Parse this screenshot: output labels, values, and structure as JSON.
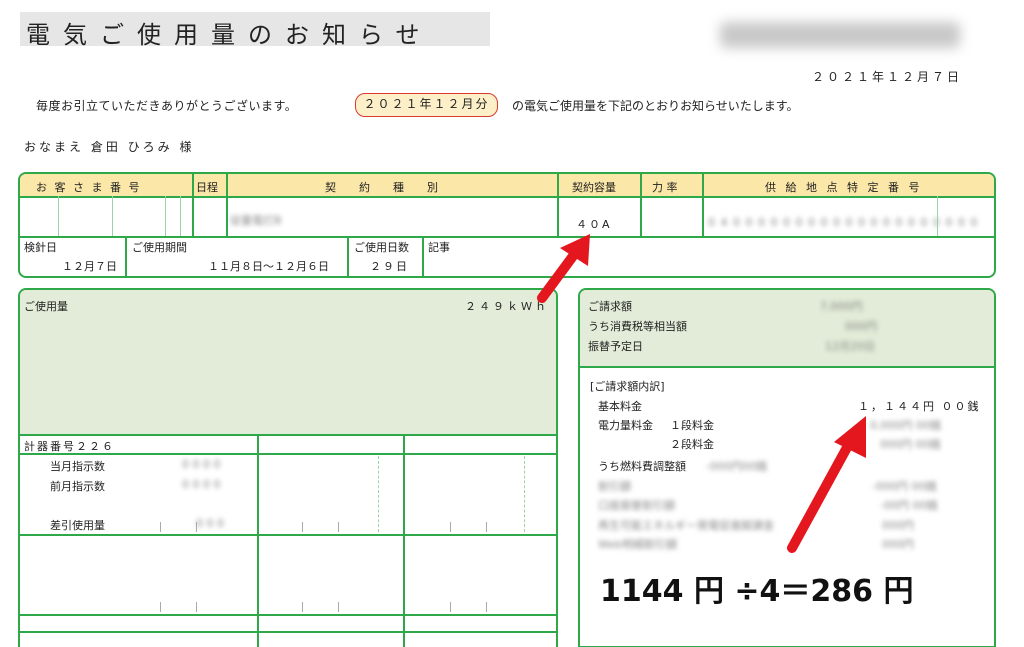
{
  "header": {
    "title": "電気ご使用量のお知らせ",
    "company": "中部電力ミライズ株式会社",
    "date": "２０２１年１２月７日"
  },
  "greeting": {
    "prefix": "毎度お引立ていただきありがとうございます。",
    "period": "２０２１年１２月分",
    "suffix": "の電気ご使用量を下記のとおりお知らせいたします。"
  },
  "customer": {
    "name_line": "おなまえ 倉田 ひろみ 様"
  },
  "contract_table": {
    "col_customer_no": "お 客 さ ま 番 号",
    "col_day": "日程",
    "col_contract_type": "契　約　種　別",
    "col_capacity": "契約容量",
    "col_power_factor": "力 率",
    "col_supply_point": "供 給 地 点 特 定 番 号",
    "contract_type_value": "従量電灯B",
    "capacity_value": "４０A",
    "supply_point_value": "0 4 0 0 0 0 0 0 0 0 0 0 0 0 0 0 0 0 0 0 0 0",
    "meter_day_label": "検針日",
    "meter_day_value": "１２月７日",
    "period_label": "ご使用期間",
    "period_value": "１１月８日～１２月６日",
    "days_label": "ご使用日数",
    "days_value": "２９日",
    "notes_label": "記事"
  },
  "usage": {
    "label": "ご使用量",
    "value": "２４９ｋＷｈ",
    "meter_no_label": "計器番号２２６",
    "current_label": "当月指示数",
    "current_value": "0 0 0 0",
    "previous_label": "前月指示数",
    "previous_value": "0 0 0 0",
    "diff_label": "差引使用量",
    "diff_value": "0 0 0"
  },
  "billing": {
    "amount_label": "ご請求額",
    "amount_value": "7,000円",
    "tax_label": "うち消費税等相当額",
    "tax_value": "000円",
    "transfer_label": "振替予定日",
    "transfer_value": "12月20日",
    "breakdown_label": "[ご請求額内訳]",
    "base_label": "基本料金",
    "base_value": "１，１４４円 ００銭",
    "energy_label": "電力量料金",
    "tier1_label": "１段料金",
    "tier1_value": "0,000円 00銭",
    "tier2_label": "２段料金",
    "tier2_value": "000円 00銭",
    "fuel_label": "うち燃料費調整額",
    "fuel_value": "-000円00銭",
    "extra_rows": [
      {
        "label": "割引額",
        "value": "-000円 00銭"
      },
      {
        "label": "口座振替割引額",
        "value": "-00円 00銭"
      },
      {
        "label": "再生可能エネルギー発電促進賦課金",
        "value": "000円"
      },
      {
        "label": "Web明細割引額",
        "value": "000円"
      }
    ]
  },
  "annotation": {
    "formula": "1144 円 ÷4＝286 円",
    "arrow_color": "#e4161e"
  },
  "colors": {
    "border": "#2fa84a",
    "header_fill": "#fbe8a8",
    "usage_fill": "#e2ecd8",
    "pill_border": "#d83a2e"
  }
}
